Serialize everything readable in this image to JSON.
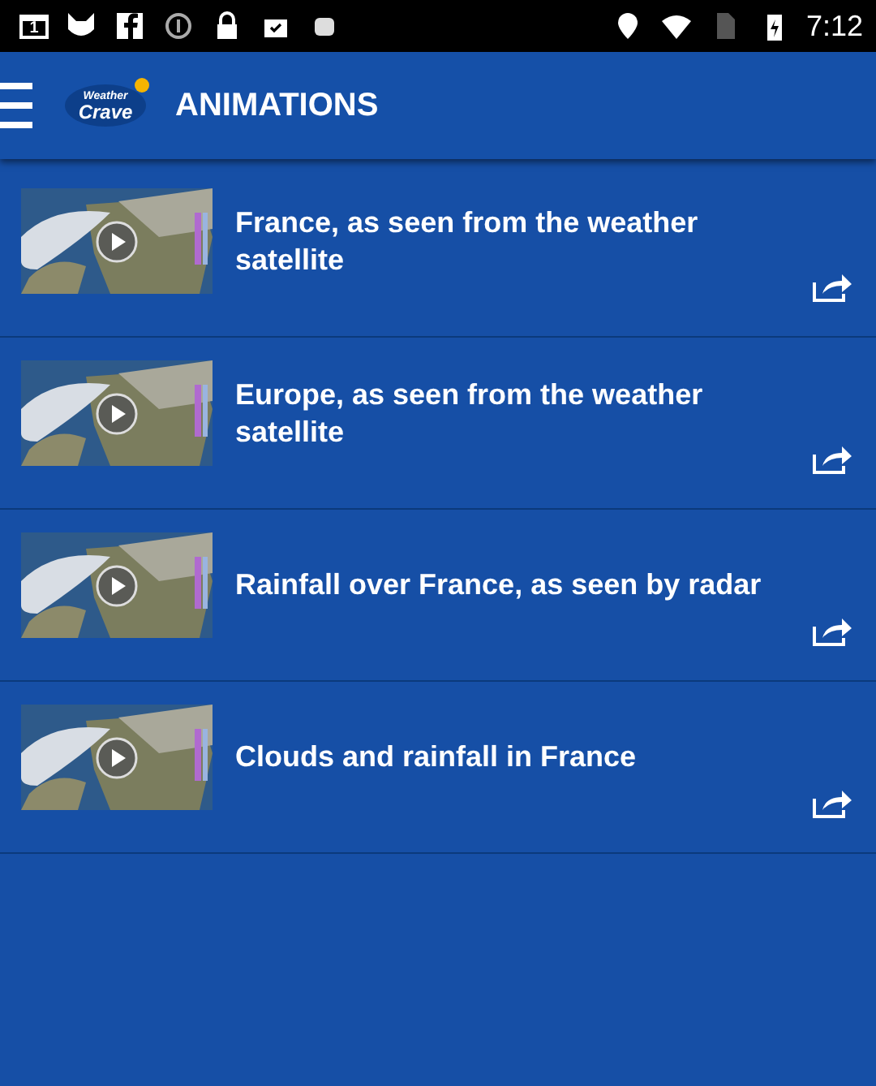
{
  "status_bar": {
    "notification_badge": "1",
    "time": "7:12"
  },
  "app_bar": {
    "logo": {
      "line_1": "Weather",
      "line_2": "Crave"
    },
    "title": "ANIMATIONS"
  },
  "animations": [
    {
      "title": "France, as seen from the weather satellite"
    },
    {
      "title": "Europe, as seen from the weather satellite"
    },
    {
      "title": "Rainfall over France, as seen by radar"
    },
    {
      "title": "Clouds and rainfall in France"
    }
  ]
}
